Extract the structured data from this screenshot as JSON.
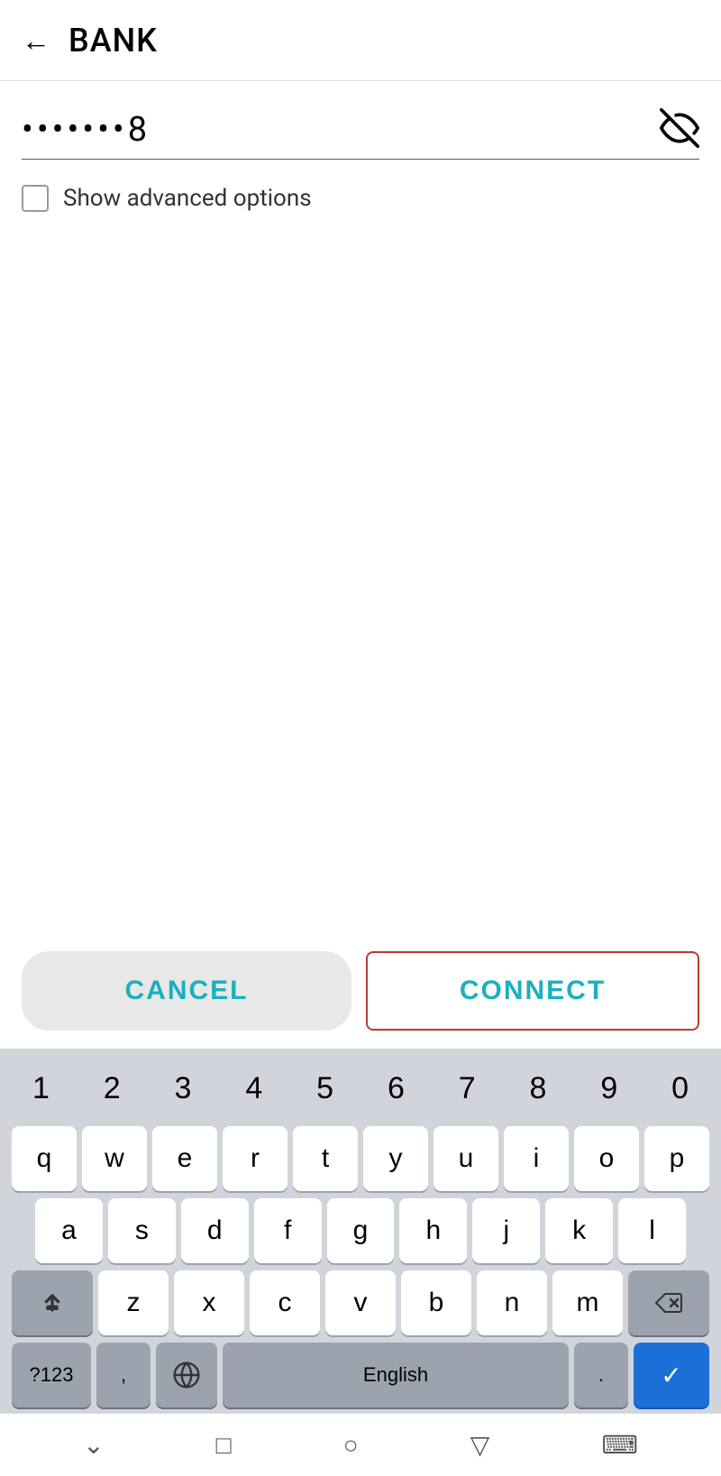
{
  "header": {
    "back_label": "←",
    "title": "BANK"
  },
  "password_field": {
    "value": "•••••••8",
    "visibility_icon": "eye-off"
  },
  "advanced_options": {
    "label": "Show advanced options",
    "checked": false
  },
  "buttons": {
    "cancel_label": "CANCEL",
    "connect_label": "CONNECT"
  },
  "keyboard": {
    "number_row": [
      "1",
      "2",
      "3",
      "4",
      "5",
      "6",
      "7",
      "8",
      "9",
      "0"
    ],
    "row1": [
      "q",
      "w",
      "e",
      "r",
      "t",
      "y",
      "u",
      "i",
      "o",
      "p"
    ],
    "row2": [
      "a",
      "s",
      "d",
      "f",
      "g",
      "h",
      "j",
      "k",
      "l"
    ],
    "row3": [
      "z",
      "x",
      "c",
      "v",
      "b",
      "n",
      "m"
    ],
    "func_row": {
      "num_switch": "?123",
      "comma": ",",
      "globe": "🌐",
      "space_label": "English",
      "period": ".",
      "enter_icon": "✓"
    }
  },
  "nav_bar": {
    "back": "⌄",
    "home": "□",
    "circle": "○",
    "triangle": "▽",
    "keyboard": "⌨"
  }
}
